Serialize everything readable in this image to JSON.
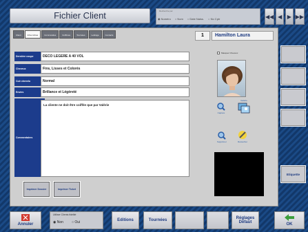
{
  "header": {
    "title": "Fichier Client",
    "search_options": [
      "Numéro",
      "Nom",
      "Date Naiss.",
      "No Cptr"
    ],
    "nav": [
      "◀◀",
      "◀",
      "▶",
      "▶▶"
    ]
  },
  "tabs": [
    "Client",
    "Infos Libres",
    "Commandes",
    "Coiffures",
    "Tournées",
    "Lettrage",
    "Contacts"
  ],
  "client": {
    "number": "1",
    "name": "Hamilton Laura"
  },
  "fields": [
    {
      "label": "Dernière coupe",
      "value": "DECO LEGERE A 40 VOL"
    },
    {
      "label": "Cheveux",
      "value": "Fins, Lisses et Colorés"
    },
    {
      "label": "Cuir chevelu",
      "value": "Normal"
    },
    {
      "label": "Envies",
      "value": "Brillance et Légèreté"
    }
  ],
  "comment": {
    "label": "Commentaires",
    "text": "La cliente ne doit être coiffée que par Valérie"
  },
  "buttons": {
    "print_dossier": "Imprimer Dossier",
    "print_ticket": "Imprimer Ticket",
    "etiquette": "Etiquette",
    "annuler": "Annuler",
    "editions": "Editions",
    "tournees": "Tournées",
    "reglages": "Réglages Défaut",
    "ok": "OK"
  },
  "photo_checkbox": "Masquer Cheveux",
  "icons": {
    "labels": [
      "Capture",
      "Galerie",
      "",
      "Supprimer",
      "Retoucher"
    ]
  },
  "fidelite": {
    "title": "Utiliser Clients fidélité",
    "options": [
      "Non",
      "Oui"
    ],
    "selected": "Non"
  },
  "colors": {
    "accent": "#1c3c8c",
    "ok_green": "#3c9e3c",
    "cancel_red": "#d23a30"
  }
}
